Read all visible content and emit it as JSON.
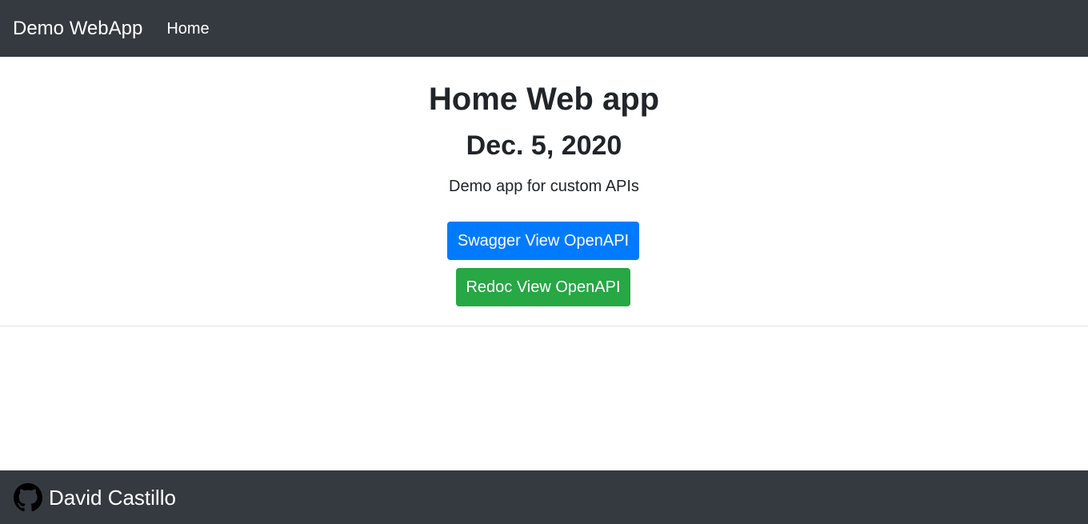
{
  "navbar": {
    "brand": "Demo WebApp",
    "links": [
      {
        "label": "Home"
      }
    ]
  },
  "main": {
    "title": "Home Web app",
    "date": "Dec. 5, 2020",
    "subtitle": "Demo app for custom APIs",
    "buttons": {
      "swagger": "Swagger View OpenAPI",
      "redoc": "Redoc View OpenAPI"
    }
  },
  "footer": {
    "icon": "github-icon",
    "name": "David Castillo"
  },
  "colors": {
    "navbar_bg": "#343a40",
    "primary": "#007bff",
    "success": "#28a745",
    "text": "#212529"
  }
}
